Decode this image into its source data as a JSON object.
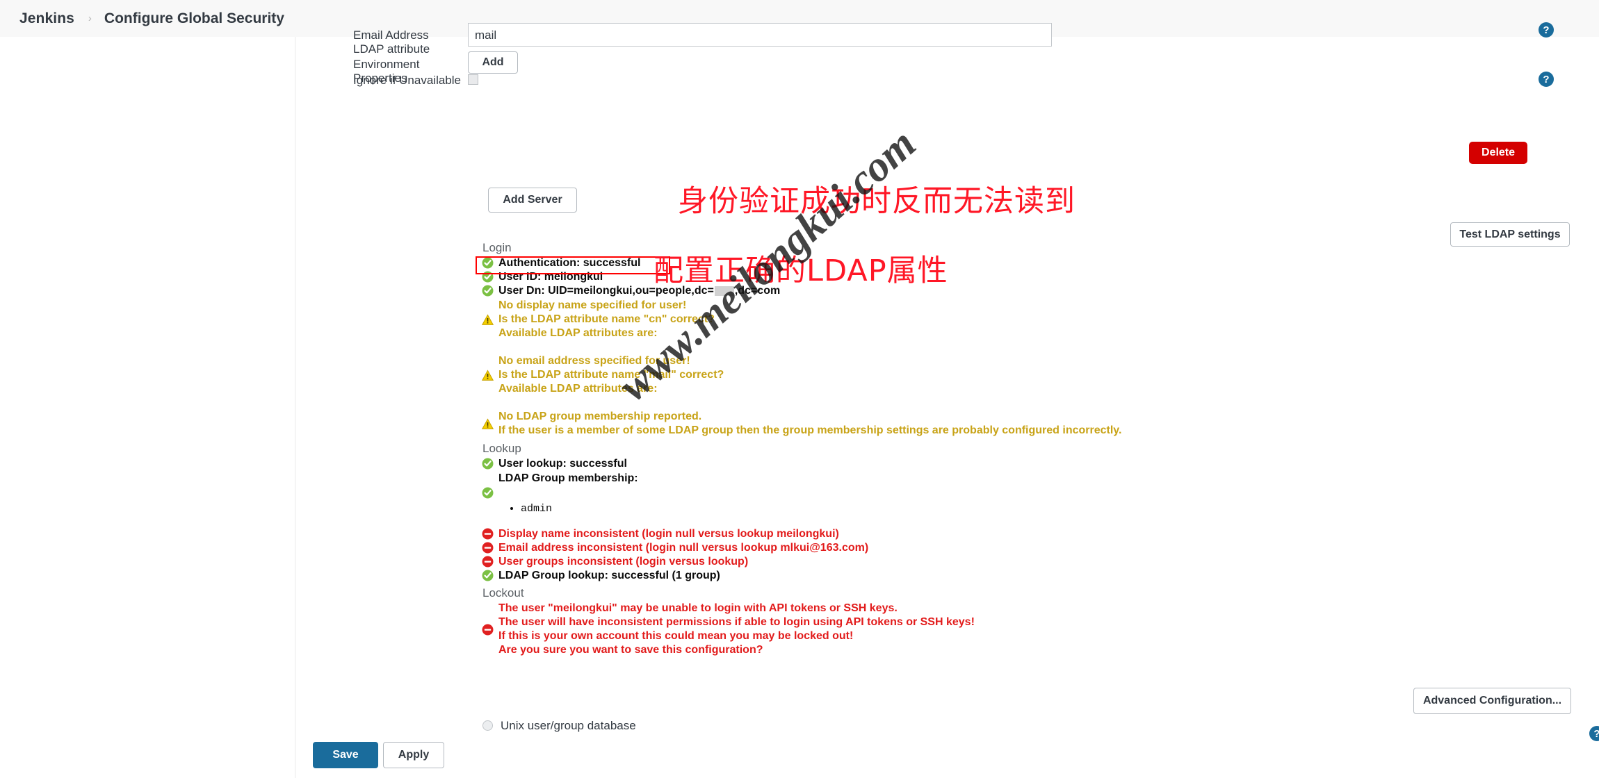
{
  "breadcrumb": {
    "root": "Jenkins",
    "separator": "›",
    "current": "Configure Global Security"
  },
  "form": {
    "email_attr_label": "Email Address LDAP attribute",
    "email_attr_value": "mail",
    "env_props_label": "Environment Properties",
    "env_props_add": "Add",
    "ignore_unavailable_label": "Ignore if Unavailable",
    "help_icon": "?",
    "delete_button": "Delete",
    "add_server_button": "Add Server",
    "test_ldap_button": "Test LDAP settings",
    "advanced_config_button": "Advanced Configuration...",
    "unix_db_label": "Unix user/group database"
  },
  "report": {
    "login_heading": "Login",
    "lookup_heading": "Lookup",
    "lockout_heading": "Lockout",
    "login_lines": [
      {
        "icon": "ok-icon",
        "status": "ok",
        "text": "Authentication: successful"
      },
      {
        "icon": "ok-icon",
        "status": "ok",
        "text": "User ID: meilongkui"
      }
    ],
    "user_dn": {
      "icon": "ok-icon",
      "prefix": "User Dn: UID=meilongkui,ou=people,dc=",
      "redacted": true,
      "suffix": ",dc=com"
    },
    "display_name_block": {
      "icon": "warning-icon",
      "status": "warn",
      "lines": [
        "No display name specified for user!",
        "Is the LDAP attribute name \"cn\" correct?",
        "Available LDAP attributes are:"
      ]
    },
    "email_block": {
      "icon": "warning-icon",
      "status": "warn",
      "lines": [
        "No email address specified for user!",
        "Is the LDAP attribute name \"mail\" correct?",
        "Available LDAP attributes are:"
      ]
    },
    "group_block": {
      "icon": "warning-icon",
      "status": "warn",
      "lines": [
        "No LDAP group membership reported.",
        "If the user is a member of some LDAP group then the group membership settings are probably configured incorrectly."
      ]
    },
    "lookup_lines": [
      {
        "icon": "ok-icon",
        "status": "ok",
        "text": "User lookup: successful"
      }
    ],
    "group_membership_label": "LDAP Group membership:",
    "group_membership_icon": "ok-icon",
    "groups": [
      "admin"
    ],
    "inconsistency_lines": [
      {
        "icon": "error-icon",
        "status": "err",
        "text": "Display name inconsistent (login null versus lookup meilongkui)"
      },
      {
        "icon": "error-icon",
        "status": "err",
        "text": "Email address inconsistent (login null versus lookup mlkui@163.com)"
      },
      {
        "icon": "error-icon",
        "status": "err",
        "text": "User groups inconsistent (login versus lookup)"
      },
      {
        "icon": "ok-icon",
        "status": "ok",
        "text": "LDAP Group lookup: successful (1 group)"
      }
    ],
    "lockout_block": {
      "icon": "error-icon",
      "status": "err",
      "lines": [
        "The user \"meilongkui\" may be unable to login with API tokens or SSH keys.",
        "The user will have inconsistent permissions if able to login using API tokens or SSH keys!",
        "If this is your own account this could mean you may be locked out!",
        "Are you sure you want to save this configuration?"
      ]
    }
  },
  "footer": {
    "save_button": "Save",
    "apply_button": "Apply"
  },
  "annotations": {
    "line1": "身份验证成功时反而无法读到",
    "line2": "配置正确的LDAP属性",
    "color": "#ff1726"
  },
  "watermark": {
    "text": "www.meilongkui.com"
  },
  "colors": {
    "accent_blue": "#1a6c9c",
    "danger_red": "#d40000",
    "warn_yellow": "#c8a317",
    "error_red": "#e21b1b",
    "ok_green": "#7bc043"
  }
}
